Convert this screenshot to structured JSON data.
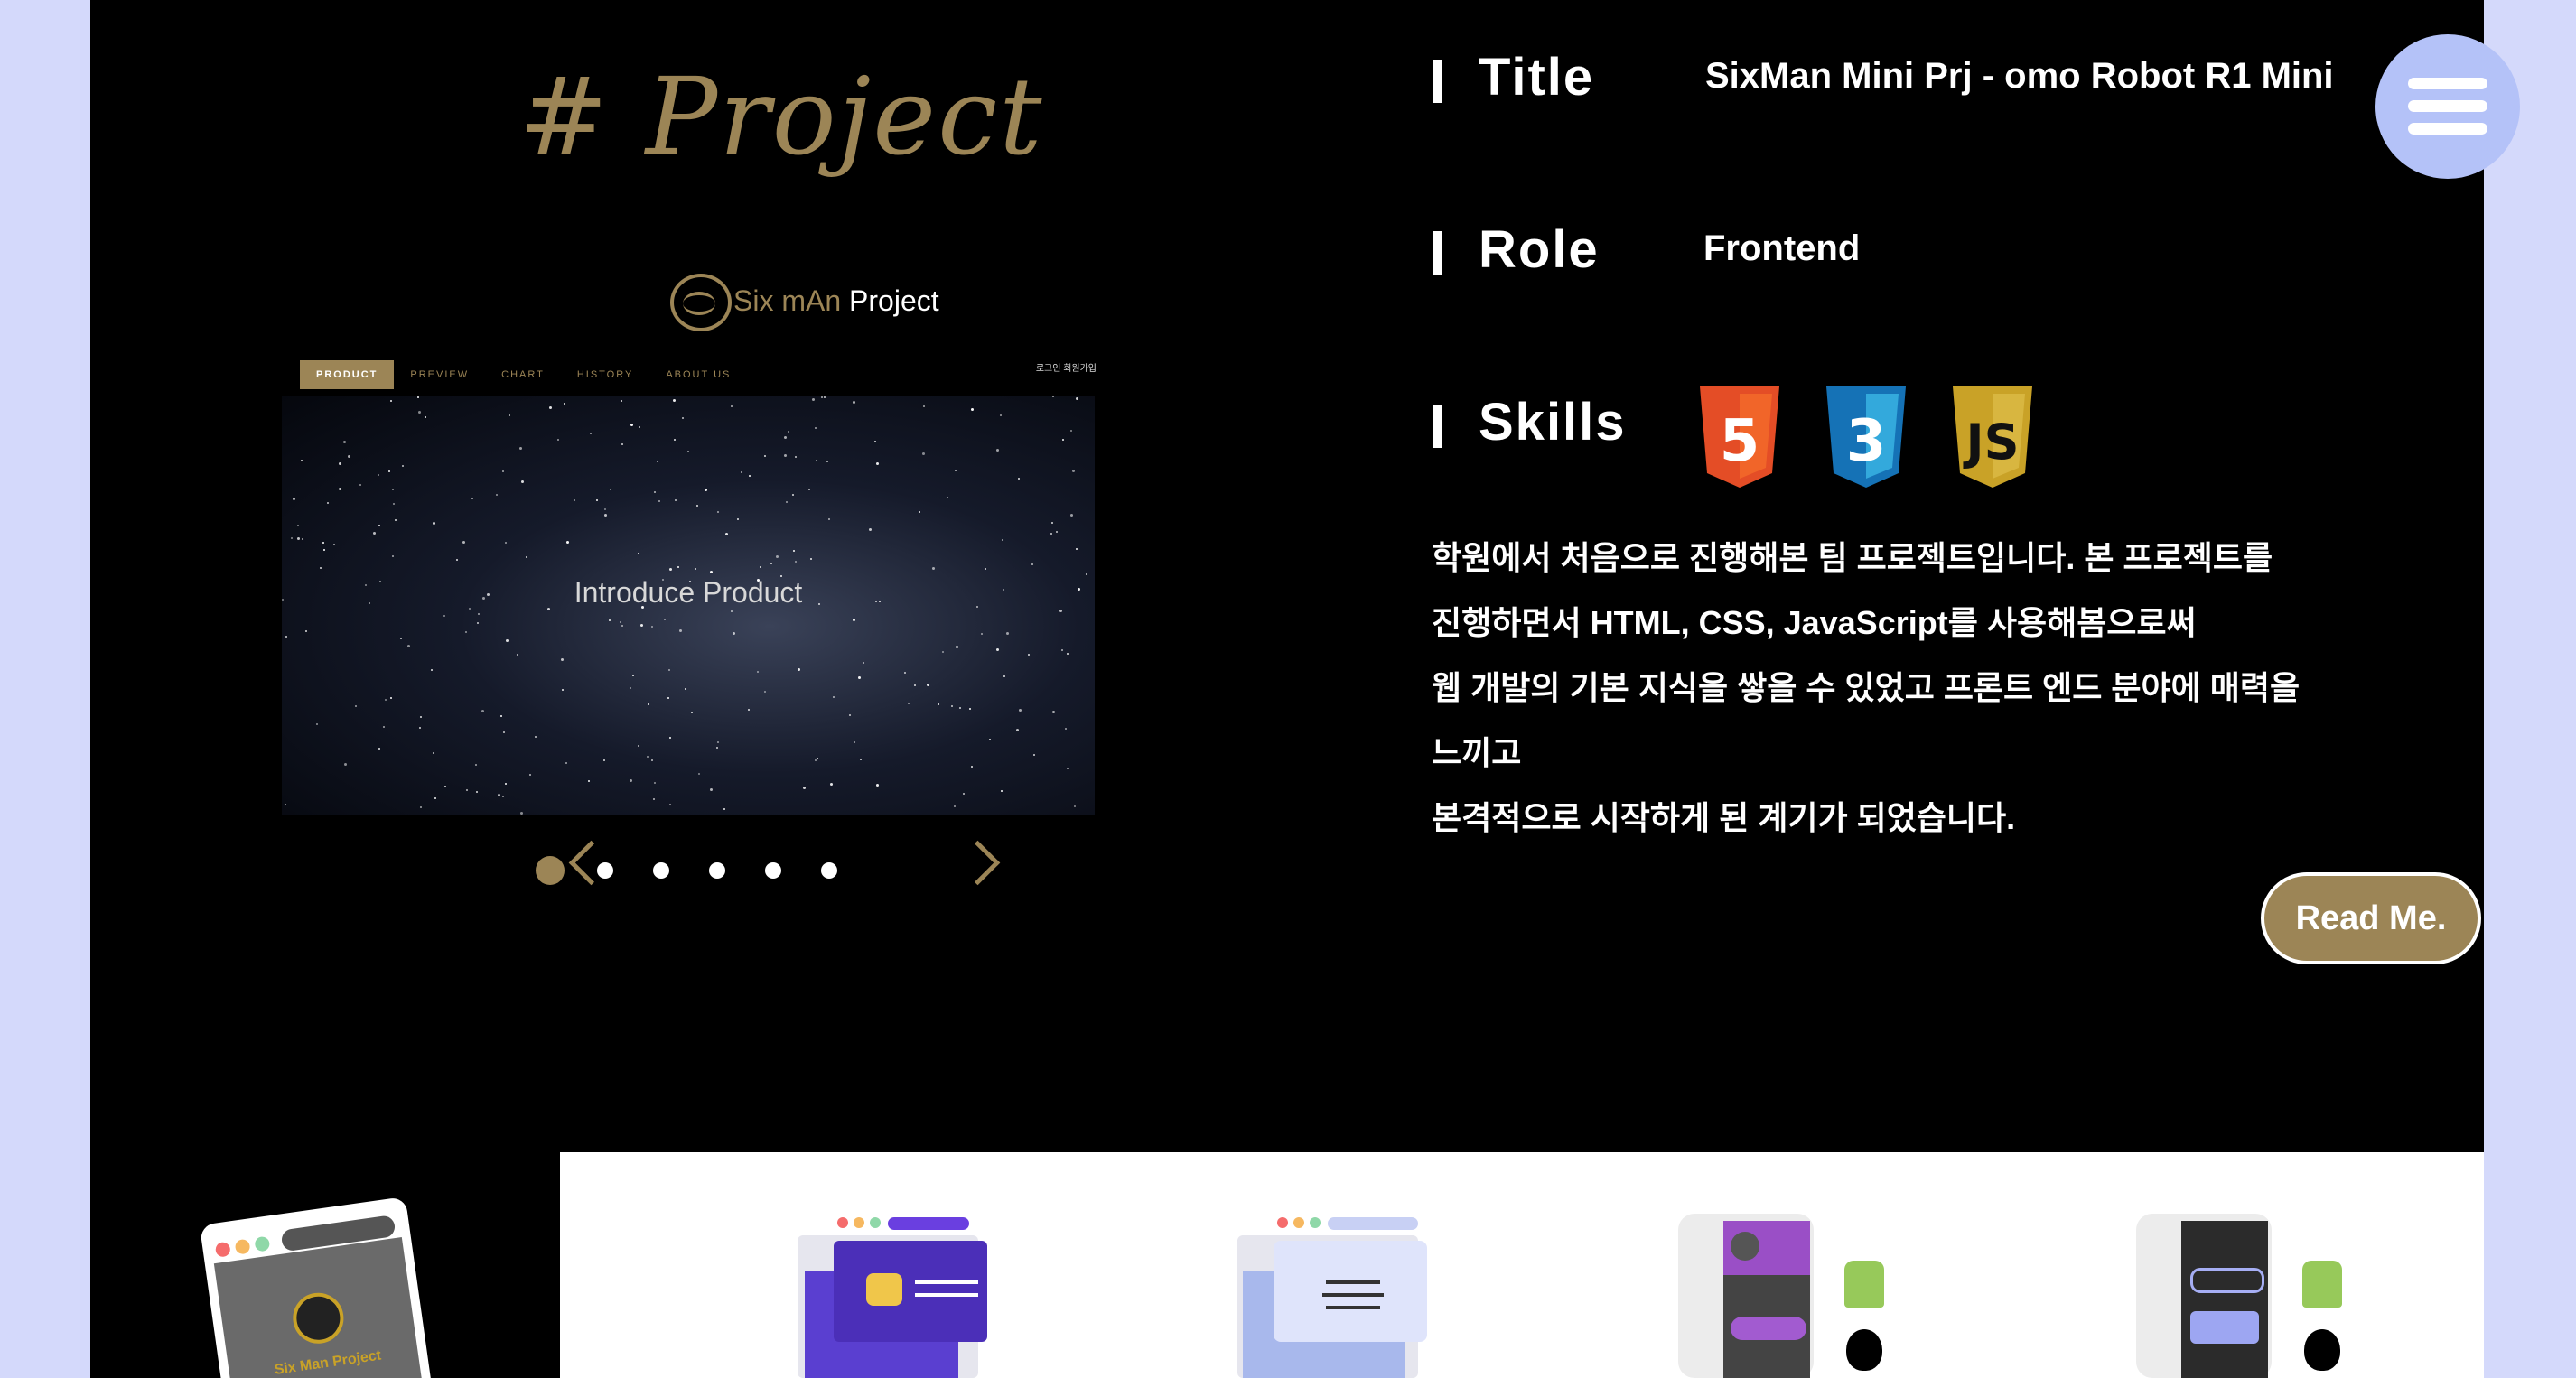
{
  "section": {
    "title": "# Project"
  },
  "preview": {
    "brand_main": "Six mAn",
    "brand_sub": "Project",
    "nav": [
      "PRODUCT",
      "PREVIEW",
      "CHART",
      "HISTORY",
      "ABOUT US"
    ],
    "login": "로그인 회원가입",
    "hero_text": "Introduce Product"
  },
  "carousel": {
    "dot_count": 6,
    "active_index": 0
  },
  "info": {
    "title_label": "Title",
    "title_value": "SixMan Mini Prj - omo Robot R1 Mini",
    "role_label": "Role",
    "role_value": "Frontend",
    "skills_label": "Skills",
    "skills": [
      {
        "icon": "html5-icon",
        "label": "5",
        "color": "#e44d26",
        "shade": "#f16529"
      },
      {
        "icon": "css3-icon",
        "label": "3",
        "color": "#1572b6",
        "shade": "#33a9dc"
      },
      {
        "icon": "js-icon",
        "label": "JS",
        "color": "#c9a227",
        "shade": "#d8b640"
      }
    ],
    "description": [
      "학원에서 처음으로 진행해본 팀 프로젝트입니다. 본 프로젝트를",
      "진행하면서 HTML, CSS, JavaScript를 사용해봄으로써",
      "웹 개발의 기본 지식을 쌓을 수 있었고 프론트 엔드 분야에 매력을",
      "느끼고",
      "본격적으로 시작하게 된 계기가 되었습니다."
    ],
    "read_button": "Read Me."
  },
  "thumbnail": {
    "label": "Six Man Project"
  },
  "colors": {
    "accent": "#9c8556",
    "side": "#d4d9fb",
    "menu": "#b4c2f8"
  }
}
